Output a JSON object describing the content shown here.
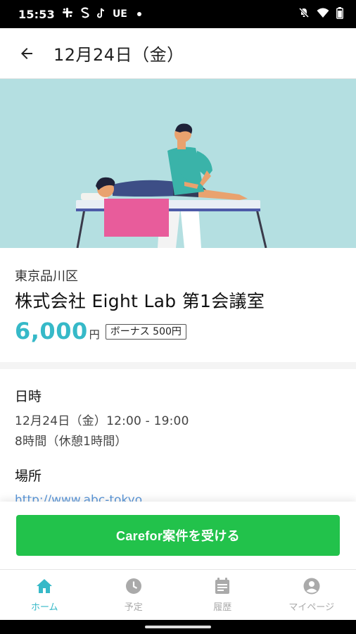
{
  "status_bar": {
    "time": "15:53",
    "icons_left": [
      "slack-icon",
      "s-icon",
      "tiktok-icon"
    ],
    "ue_label": "UE",
    "icons_right": [
      "mute-icon",
      "wifi-icon",
      "battery-icon"
    ]
  },
  "header": {
    "title": "12月24日（金）",
    "back_icon": "arrow-left-icon"
  },
  "job": {
    "area": "東京品川区",
    "venue": "株式会社 Eight Lab 第1会議室",
    "price": "6,000",
    "price_unit": "円",
    "bonus": "ボーナス 500円"
  },
  "datetime_section": {
    "heading": "日時",
    "line1": "12月24日（金）12:00 - 19:00",
    "line2": "8時間（休憩1時間）"
  },
  "place_section": {
    "heading": "場所",
    "link": "http://www.abc-tokyo"
  },
  "cta": {
    "label": "Carefor案件を受ける"
  },
  "bottom_nav": {
    "items": [
      {
        "label": "ホーム",
        "icon": "home-icon",
        "active": true
      },
      {
        "label": "予定",
        "icon": "clock-icon",
        "active": false
      },
      {
        "label": "履歴",
        "icon": "calendar-icon",
        "active": false
      },
      {
        "label": "マイページ",
        "icon": "account-icon",
        "active": false
      }
    ]
  },
  "colors": {
    "accent": "#36b9c8",
    "cta": "#22c24b",
    "link": "#5a96d8",
    "hero_bg": "#b4dfe1",
    "inactive_nav": "#aaaaaa"
  }
}
